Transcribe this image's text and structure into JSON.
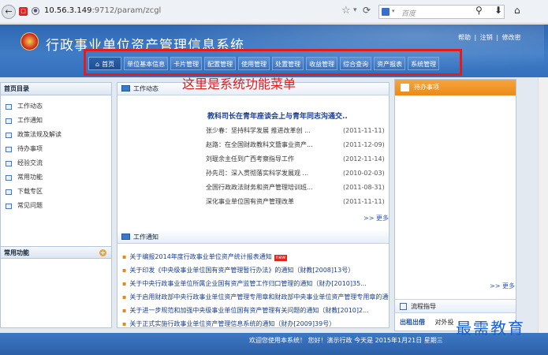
{
  "browser": {
    "url_host": "10.56.3.149",
    "url_path": ":9712/param/zcgl",
    "search_placeholder": "百度",
    "icons": {
      "back": "back-arrow-icon",
      "favicon": "site-favicon-icon",
      "star": "bookmark-star-icon",
      "refresh": "refresh-icon",
      "search": "search-icon",
      "download": "download-icon",
      "home": "home-icon"
    }
  },
  "header": {
    "title": "行政事业单位资产管理信息系统",
    "links": [
      "帮助",
      "|",
      "注销",
      "|",
      "修改密"
    ],
    "annotation": "这里是系统功能菜单"
  },
  "menu": [
    {
      "label": "首页",
      "active": true
    },
    {
      "label": "单位基本信息"
    },
    {
      "label": "卡片管理"
    },
    {
      "label": "配置管理"
    },
    {
      "label": "使用管理"
    },
    {
      "label": "处置管理"
    },
    {
      "label": "收益管理"
    },
    {
      "label": "综合查询"
    },
    {
      "label": "资产报表"
    },
    {
      "label": "系统管理"
    }
  ],
  "sidebar": {
    "title": "首页目录",
    "items": [
      "工作动态",
      "工作通知",
      "政策法规及解读",
      "待办事项",
      "经验交流",
      "常用功能",
      "下载专区",
      "常见问题"
    ],
    "common_title": "常用功能"
  },
  "news": {
    "title": "工作动态",
    "headline": "教科司长在青年座谈会上与青年同志沟通交..",
    "rows": [
      {
        "title": "张少春：坚持科学发展 推进改革创 ...",
        "date": "(2011-11-11)"
      },
      {
        "title": "赵路：在全国财政教科文暨事业资产...",
        "date": "(2011-12-09)"
      },
      {
        "title": "刘琨余主任到广西考察指导工作",
        "date": "(2012-11-14)"
      },
      {
        "title": "孙先司：深入贯彻落实科学发展观 ...",
        "date": "(2010-02-03)"
      },
      {
        "title": "全国行政政法财务和资产管理培训班...",
        "date": "(2011-08-31)"
      },
      {
        "title": "深化事业单位国有资产管理改革",
        "date": "(2011-11-11)"
      }
    ],
    "more": ">> 更多"
  },
  "notices": {
    "title": "工作通知",
    "new_badge": "new",
    "items": [
      "关于编报2014年度行政事业单位资产统计报表通知",
      "关于印发《中央级事业单位国有资产管理暂行办法》的通知（财教[2008]13号）",
      "关于中央行政事业单位所属企业国有资产监管工作归口管理的通知（财办[2010]35...",
      "关于启用财政部中央行政事业单位资产管理专用章和财政部中央事业单位资产管理专用章的通知",
      "关于进一步规范和加强中央级事业单位国有资产管理有关问题的通知（财教[2010]2...",
      "关于正式实施行政事业单位资产管理信息系统的通知（财办[2009]39号）"
    ]
  },
  "todo": {
    "title": "待办事项",
    "more": ">> 更多"
  },
  "guide": {
    "title": "流程指导",
    "tabs": [
      "出租出借",
      "对外投"
    ]
  },
  "footer": {
    "text": "欢迎您使用本系统！  您好！演示行政 今天是 2015年1月21日 星期三"
  },
  "watermark": "最需教育",
  "colors": {
    "header_blue": "#3470bd",
    "annotation_red": "#e21b1b",
    "todo_orange": "#ea8a18"
  }
}
